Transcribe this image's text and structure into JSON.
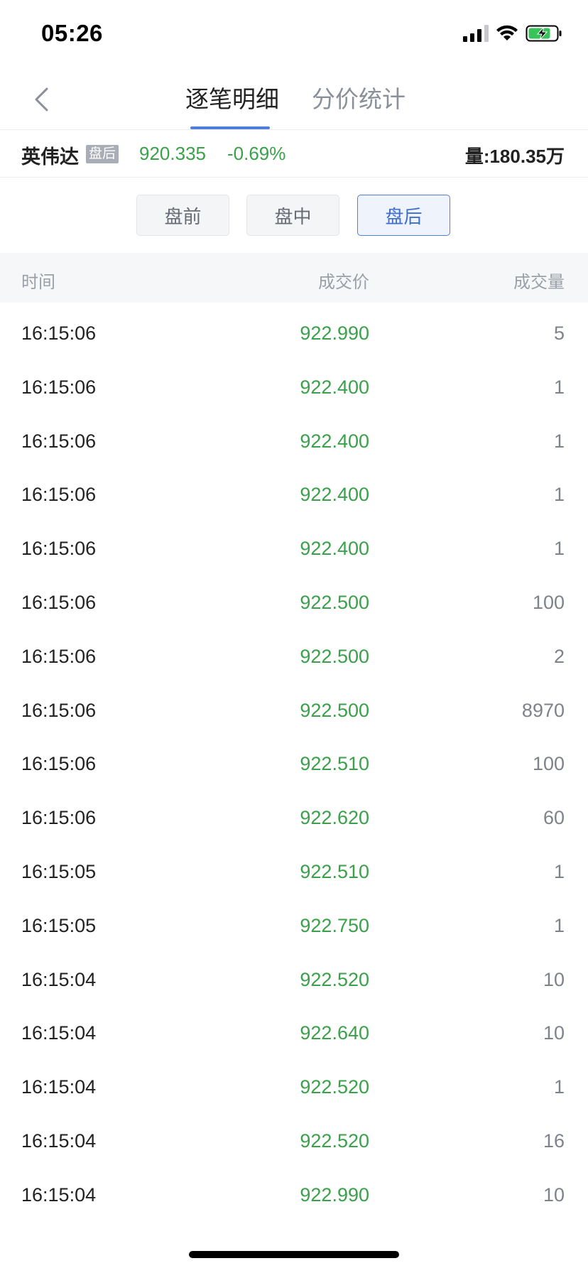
{
  "status_bar": {
    "time": "05:26"
  },
  "nav": {
    "tabs": [
      {
        "label": "逐笔明细",
        "active": true
      },
      {
        "label": "分价统计",
        "active": false
      }
    ],
    "back_icon": "chevron-left-icon"
  },
  "quote": {
    "name": "英伟达",
    "session_badge": "盘后",
    "price": "920.335",
    "change": "-0.69%",
    "volume": "量:180.35万",
    "price_color": "#3aa14a"
  },
  "session_filter": {
    "options": [
      "盘前",
      "盘中",
      "盘后"
    ],
    "selected": "盘后"
  },
  "table": {
    "headers": {
      "time": "时间",
      "price": "成交价",
      "volume": "成交量"
    },
    "rows": [
      {
        "time": "16:15:06",
        "price": "922.990",
        "volume": "5"
      },
      {
        "time": "16:15:06",
        "price": "922.400",
        "volume": "1"
      },
      {
        "time": "16:15:06",
        "price": "922.400",
        "volume": "1"
      },
      {
        "time": "16:15:06",
        "price": "922.400",
        "volume": "1"
      },
      {
        "time": "16:15:06",
        "price": "922.400",
        "volume": "1"
      },
      {
        "time": "16:15:06",
        "price": "922.500",
        "volume": "100"
      },
      {
        "time": "16:15:06",
        "price": "922.500",
        "volume": "2"
      },
      {
        "time": "16:15:06",
        "price": "922.500",
        "volume": "8970"
      },
      {
        "time": "16:15:06",
        "price": "922.510",
        "volume": "100"
      },
      {
        "time": "16:15:06",
        "price": "922.620",
        "volume": "60"
      },
      {
        "time": "16:15:05",
        "price": "922.510",
        "volume": "1"
      },
      {
        "time": "16:15:05",
        "price": "922.750",
        "volume": "1"
      },
      {
        "time": "16:15:04",
        "price": "922.520",
        "volume": "10"
      },
      {
        "time": "16:15:04",
        "price": "922.640",
        "volume": "10"
      },
      {
        "time": "16:15:04",
        "price": "922.520",
        "volume": "1"
      },
      {
        "time": "16:15:04",
        "price": "922.520",
        "volume": "16"
      },
      {
        "time": "16:15:04",
        "price": "922.990",
        "volume": "10"
      }
    ]
  },
  "colors": {
    "accent": "#4f7fd9",
    "down": "#3aa14a"
  }
}
